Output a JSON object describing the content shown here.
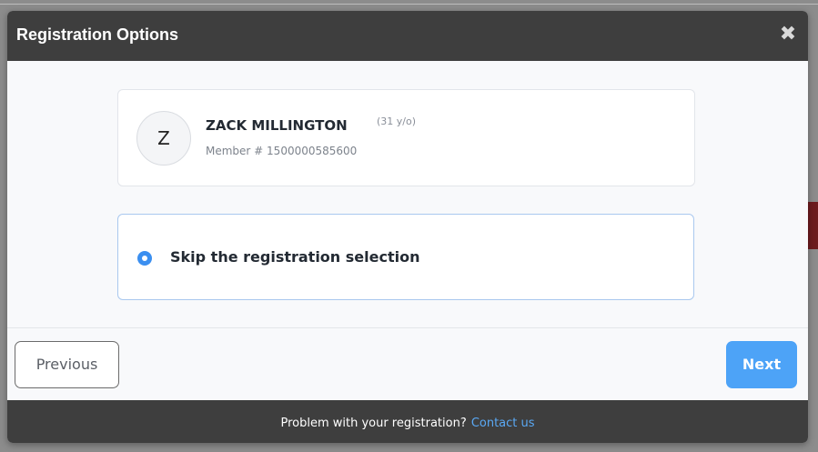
{
  "modal": {
    "title": "Registration Options",
    "close_glyph": "✖"
  },
  "member": {
    "initial": "Z",
    "name": "ZACK MILLINGTON",
    "age": "(31 y/o)",
    "number": "Member # 1500000585600"
  },
  "option": {
    "label": "Skip the registration selection",
    "selected": true
  },
  "buttons": {
    "previous": "Previous",
    "next": "Next"
  },
  "footer": {
    "text": "Problem with your registration?",
    "link": "Contact us"
  },
  "colors": {
    "header_bg": "#3e3e3e",
    "accent": "#4da3f7",
    "link": "#5aa9f5"
  },
  "icons": {
    "close": "close-icon",
    "radio": "radio-selected-icon"
  }
}
